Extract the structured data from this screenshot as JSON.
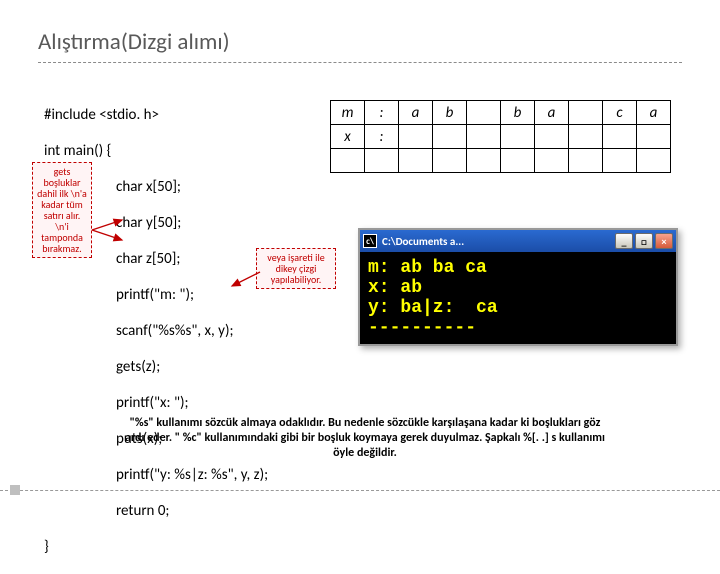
{
  "title": "Alıştırma(Dizgi alımı)",
  "code": {
    "l1": "#include <stdio. h>",
    "l2": "int main() {",
    "l3": "char x[50];",
    "l4": "char y[50];",
    "l5": "char z[50];",
    "l6": "printf(\"m: \");",
    "l7": "scanf(\"%s%s\", x, y);",
    "l8": "gets(z);",
    "l9": "printf(\"x: \");",
    "l10": "puts(x);",
    "l11": "printf(\"y: %s|z: %s\", y, z);",
    "l12": "return 0;",
    "l13": "}"
  },
  "notes": {
    "left": "gets boşluklar dahil ilk \\n'a kadar tüm satırı alır. \\n'i tamponda bırakmaz.",
    "mid": "veya işareti ile dikey çizgi yapılabiliyor."
  },
  "table": {
    "r1": [
      "m",
      ":",
      "a",
      "b",
      "",
      "b",
      "a",
      "",
      "c",
      "a"
    ],
    "r2": [
      "x",
      ":",
      "",
      "",
      "",
      "",
      "",
      "",
      "",
      ""
    ],
    "r3": [
      "",
      "",
      "",
      "",
      "",
      "",
      "",
      "",
      "",
      ""
    ]
  },
  "console": {
    "title": "C:\\Documents a...",
    "line1": "m: ab ba ca",
    "line2": "x: ab",
    "line3": "y: ba|z:  ca",
    "line4": "----------"
  },
  "footnote": "\"%s\" kullanımı sözcük almaya odaklıdır. Bu nedenle sözcükle karşılaşana kadar ki boşlukları göz ardı eder. \" %c\" kullanımındaki gibi bir boşluk koymaya gerek duyulmaz. Şapkalı %[. .] s kullanımı öyle değildir."
}
